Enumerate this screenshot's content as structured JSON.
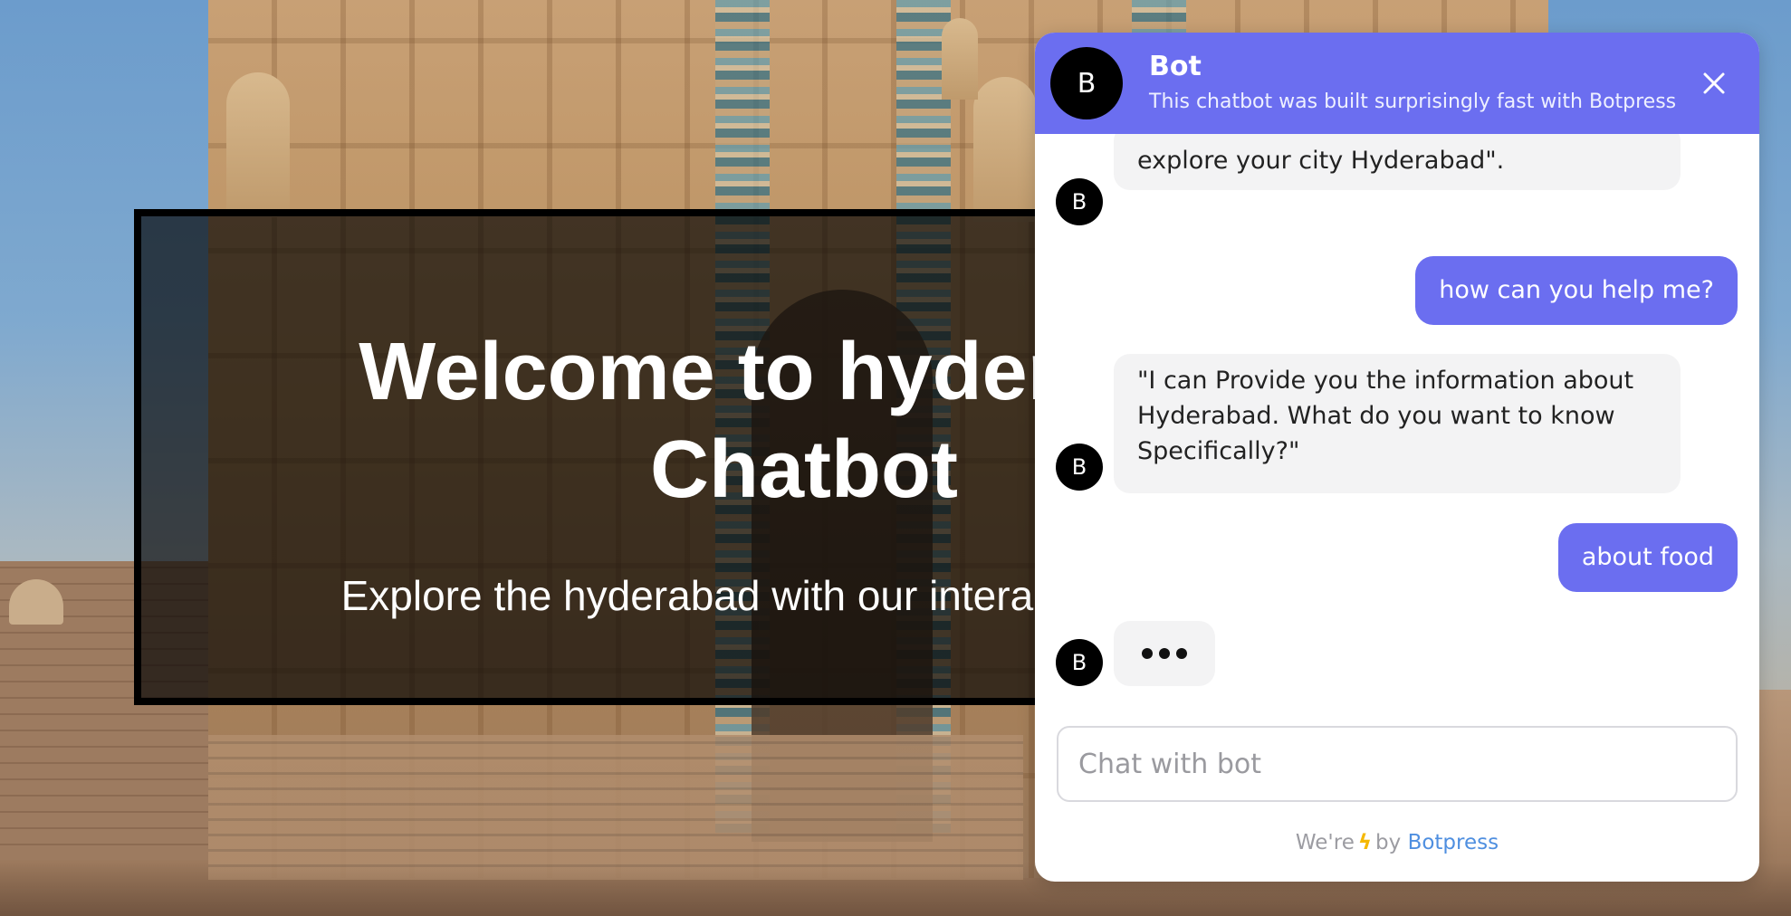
{
  "hero": {
    "title_line1": "Welcome to hyderabad",
    "title_line2": "Chatbot",
    "subtitle": "Explore the hyderabad with our interactive chatbot"
  },
  "chat": {
    "avatar_letter": "B",
    "bot_name": "Bot",
    "bot_description": "This chatbot was built surprisingly fast with Botpress",
    "close_icon": "close-icon",
    "messages": [
      {
        "from": "bot",
        "text": "explore your city Hyderabad\"."
      },
      {
        "from": "user",
        "text": "how can you help me?"
      },
      {
        "from": "bot",
        "text": "\"I can Provide you the information about Hyderabad. What do you want to know Specifically?\""
      },
      {
        "from": "user",
        "text": "about food"
      },
      {
        "from": "bot",
        "typing": true
      }
    ],
    "input_placeholder": "Chat with bot",
    "footer": {
      "prefix": "We're",
      "bolt_icon": "lightning-icon",
      "by": "by",
      "brand": "Botpress"
    },
    "colors": {
      "accent": "#6b6ef0",
      "bot_bubble": "#f3f3f4",
      "link": "#4f8fe0",
      "bolt": "#f5b800"
    }
  }
}
